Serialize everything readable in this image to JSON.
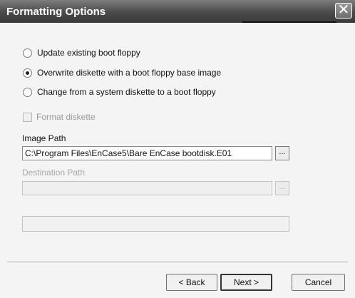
{
  "window": {
    "title": "Formatting Options",
    "close_glyph": "✕"
  },
  "options": [
    {
      "label": "Update existing boot floppy",
      "checked": false
    },
    {
      "label": "Overwrite diskette with a boot floppy base image",
      "checked": true
    },
    {
      "label": "Change from a system diskette to a boot floppy",
      "checked": false
    }
  ],
  "format_diskette": {
    "label": "Format diskette",
    "checked": false,
    "enabled": false
  },
  "image_path": {
    "label": "Image Path",
    "value": "C:\\Program Files\\EnCase5\\Bare EnCase bootdisk.E01",
    "browse_label": "..."
  },
  "destination_path": {
    "label": "Destination Path",
    "value": "",
    "browse_label": "...",
    "enabled": false
  },
  "progress": {
    "value": 0
  },
  "buttons": {
    "back": "< Back",
    "next": "Next >",
    "cancel": "Cancel"
  }
}
